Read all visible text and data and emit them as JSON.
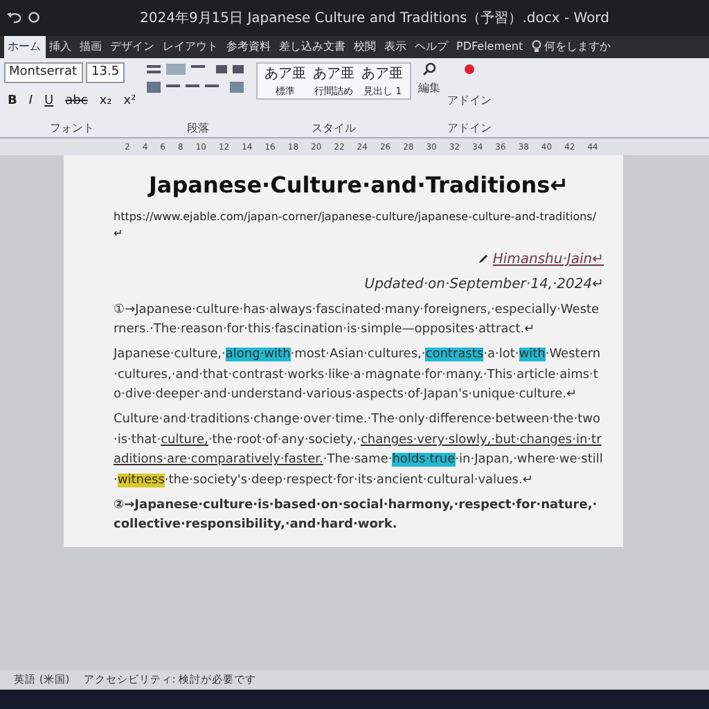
{
  "window": {
    "title": "2024年9月15日 Japanese Culture and Traditions（予習）.docx  -  Word"
  },
  "tabs": [
    {
      "label": "ホーム",
      "selected": true
    },
    {
      "label": "挿入",
      "selected": false
    },
    {
      "label": "描画",
      "selected": false
    },
    {
      "label": "デザイン",
      "selected": false
    },
    {
      "label": "レイアウト",
      "selected": false
    },
    {
      "label": "参考資料",
      "selected": false
    },
    {
      "label": "差し込み文書",
      "selected": false
    },
    {
      "label": "校閲",
      "selected": false
    },
    {
      "label": "表示",
      "selected": false
    },
    {
      "label": "ヘルプ",
      "selected": false
    },
    {
      "label": "PDFelement",
      "selected": false
    }
  ],
  "tell_me": {
    "placeholder": "何をしますか"
  },
  "ribbon": {
    "font_name": "Montserrat",
    "font_size": "13.5",
    "format_buttons": [
      "B",
      "I",
      "U",
      "abc",
      "x₂",
      "x²"
    ],
    "group_labels": [
      "フォント",
      "段落",
      "スタイル",
      "アドイン"
    ],
    "styles": [
      {
        "preview": "あア亜",
        "label": "標準"
      },
      {
        "preview": "あア亜",
        "label": "行間詰め"
      },
      {
        "preview": "あア亜",
        "label": "見出し 1"
      }
    ],
    "edit_label": "編集",
    "addin_label": "アドイン"
  },
  "ruler": {
    "ticks": [
      "2",
      "4",
      "6",
      "8",
      "10",
      "12",
      "14",
      "16",
      "18",
      "20",
      "22",
      "24",
      "26",
      "28",
      "30",
      "32",
      "34",
      "36",
      "38",
      "40",
      "42",
      "44"
    ]
  },
  "document": {
    "title": "Japanese·Culture·and·Traditions↵",
    "url": "https://www.ejable.com/japan-corner/japanese-culture/japanese-culture-and-traditions/↵",
    "author": "Himanshu·Jain↵",
    "updated": "Updated·on·September·14,·2024↵",
    "paragraphs": [
      {
        "number": "①",
        "bold": false,
        "runs": [
          {
            "kind": "plain",
            "text": "→Japanese·culture·has·always·fascinated·many·foreigners,·especially·Westerners.·The·reason·for·this·fascination·is·simple—opposites·attract.↵"
          }
        ]
      },
      {
        "bold": false,
        "runs": [
          {
            "kind": "plain",
            "text": "Japanese·culture,·"
          },
          {
            "kind": "highlight",
            "color": "#22b8d0",
            "text": "along·with"
          },
          {
            "kind": "plain",
            "text": "·most·Asian·cultures,·"
          },
          {
            "kind": "highlight",
            "color": "#22b8d0",
            "text": "contrasts"
          },
          {
            "kind": "plain",
            "text": "·a·lot·"
          },
          {
            "kind": "highlight",
            "color": "#22b8d0",
            "text": "with"
          },
          {
            "kind": "plain",
            "text": "·Western·cultures,·and·that·contrast·works·like·a·magnate·for·many.·This·article·aims·to·dive·deeper·and·understand·various·aspects·of·Japan's·unique·culture.↵"
          }
        ]
      },
      {
        "bold": false,
        "runs": [
          {
            "kind": "plain",
            "text": "Culture·and·traditions·change·over·time.·The·only·difference·between·the·two·is·that·"
          },
          {
            "kind": "underline",
            "text": "culture,"
          },
          {
            "kind": "plain",
            "text": "·the·root·of·any·society,·"
          },
          {
            "kind": "underline",
            "text": "changes·very·slowly,·but·changes·in·traditions·are·comparatively·faster."
          },
          {
            "kind": "plain",
            "text": "·The·same·"
          },
          {
            "kind": "highlight",
            "color": "#22b8d0",
            "text": "holds·true"
          },
          {
            "kind": "plain",
            "text": "·in·Japan,·where·we·still·"
          },
          {
            "kind": "highlight",
            "color": "#d8c82a",
            "text": "witness"
          },
          {
            "kind": "plain",
            "text": "·the·society's·deep·respect·for·its·ancient·cultural·values.↵"
          }
        ]
      },
      {
        "number": "②",
        "bold": true,
        "runs": [
          {
            "kind": "plain",
            "text": "→Japanese·culture·is·based·on·social·harmony,·respect·for·nature,·collective·responsibility,·and·hard·work."
          }
        ]
      }
    ]
  },
  "status_bar": {
    "items": [
      "英語 (米国)",
      "アクセシビリティ: 検討が必要です"
    ]
  }
}
